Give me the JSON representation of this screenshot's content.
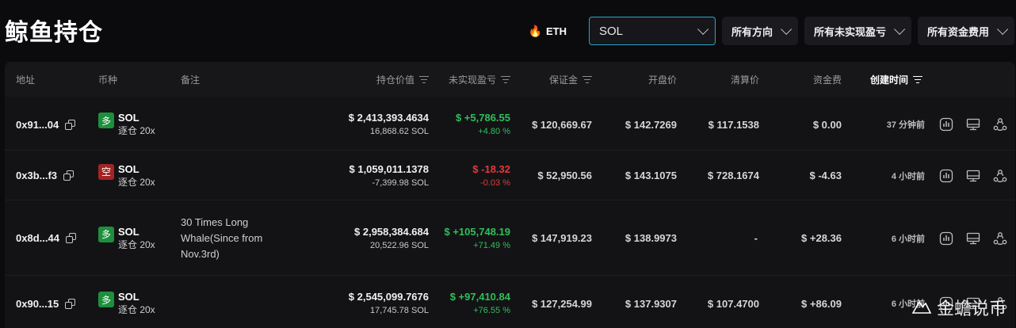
{
  "page": {
    "title": "鲸鱼持仓"
  },
  "filters": {
    "eth_label": "ETH",
    "symbol_value": "SOL",
    "direction_label": "所有方向",
    "pnl_label": "所有未实现盈亏",
    "funding_label": "所有资金费用"
  },
  "table": {
    "headers": {
      "address": "地址",
      "coin": "币种",
      "note": "备注",
      "value": "持仓价值",
      "pnl": "未实现盈亏",
      "margin": "保证金",
      "entry": "开盘价",
      "liq": "清算价",
      "funding": "资金费",
      "created": "创建时间"
    },
    "rows": [
      {
        "address": "0x91...04",
        "direction": "多",
        "coin": "SOL",
        "leverage": "逐仓 20x",
        "note": "",
        "value": "$ 2,413,393.4634",
        "size": "16,868.62 SOL",
        "pnl": "$ +5,786.55",
        "pnl_pct": "+4.80 %",
        "margin": "$ 120,669.67",
        "entry": "$ 142.7269",
        "liq": "$ 117.1538",
        "funding": "$ 0.00",
        "created": "37 分钟前"
      },
      {
        "address": "0x3b...f3",
        "direction": "空",
        "coin": "SOL",
        "leverage": "逐仓 20x",
        "note": "",
        "value": "$ 1,059,011.1378",
        "size": "-7,399.98 SOL",
        "pnl": "$ -18.32",
        "pnl_pct": "-0.03 %",
        "margin": "$ 52,950.56",
        "entry": "$ 143.1075",
        "liq": "$ 728.1674",
        "funding": "$ -4.63",
        "created": "4 小时前"
      },
      {
        "address": "0x8d...44",
        "direction": "多",
        "coin": "SOL",
        "leverage": "逐仓 20x",
        "note": "30 Times Long Whale(Since from Nov.3rd)",
        "value": "$ 2,958,384.684",
        "size": "20,522.96 SOL",
        "pnl": "$ +105,748.19",
        "pnl_pct": "+71.49 %",
        "margin": "$ 147,919.23",
        "entry": "$ 138.9973",
        "liq": "-",
        "funding": "$ +28.36",
        "created": "6 小时前"
      },
      {
        "address": "0x90...15",
        "direction": "多",
        "coin": "SOL",
        "leverage": "逐仓 20x",
        "note": "",
        "value": "$ 2,545,099.7676",
        "size": "17,745.78 SOL",
        "pnl": "$ +97,410.84",
        "pnl_pct": "+76.55 %",
        "margin": "$ 127,254.99",
        "entry": "$ 137.9307",
        "liq": "$ 107.4700",
        "funding": "$ +86.09",
        "created": "6 小时前"
      }
    ]
  },
  "watermark": "金蟾说币",
  "colors": {
    "positive": "#2fbf5a",
    "negative": "#e23a3a",
    "long_badge": "#1e8f3d",
    "short_badge": "#a32424",
    "select_border": "#29a3c7"
  }
}
